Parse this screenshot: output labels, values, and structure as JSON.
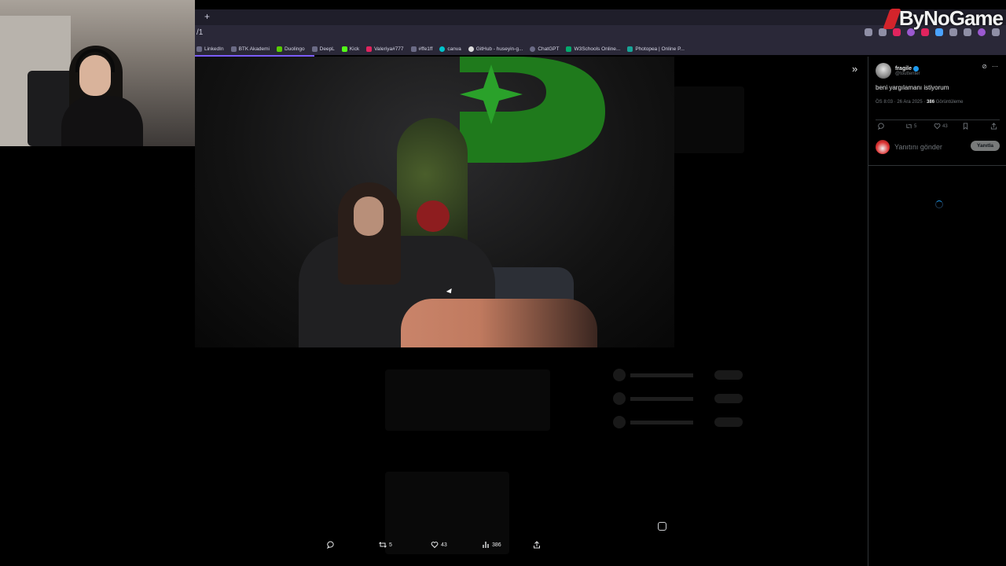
{
  "browser": {
    "new_tab_label": "+",
    "url": "/1",
    "bookmarks": [
      {
        "label": "LinkedIn",
        "icon": "linkedin-icon"
      },
      {
        "label": "BTK Akademi",
        "icon": "btk-icon"
      },
      {
        "label": "Duolingo",
        "icon": "duolingo-icon"
      },
      {
        "label": "DeepL",
        "icon": "deepl-icon"
      },
      {
        "label": "Kick",
        "icon": "kick-icon"
      },
      {
        "label": "Valeriya#777",
        "icon": "valeriya-icon"
      },
      {
        "label": "#ffe1ff",
        "icon": "color-icon"
      },
      {
        "label": "canva",
        "icon": "canva-icon"
      },
      {
        "label": "GitHub - huseyin-g...",
        "icon": "github-icon"
      },
      {
        "label": "ChatGPT",
        "icon": "chatgpt-icon"
      },
      {
        "label": "W3Schools Online...",
        "icon": "w3schools-icon"
      },
      {
        "label": "Photopea | Online P...",
        "icon": "photopea-icon"
      }
    ]
  },
  "watermark": {
    "text": "ByNoGame"
  },
  "viewer": {
    "expand_icon": "»",
    "actions": {
      "reply_count": "",
      "retweet_count": "5",
      "like_count": "43",
      "views_count": "386"
    }
  },
  "tweet": {
    "display_name": "fragile",
    "handle": "@touttenter",
    "text": "beni yargılamanı istiyorum",
    "timestamp": "ÖS 8:03 · 26 Ara 2025 ·",
    "views_number": "386",
    "views_label": "Görüntüleme",
    "stats": {
      "replies": "",
      "retweets": "5",
      "likes": "43"
    },
    "reply_placeholder": "Yanıtını gönder",
    "reply_button": "Yanıtla"
  },
  "colors": {
    "accent": "#1d9bf0",
    "brand_red": "#d3242b",
    "progress": "#7b5cff"
  }
}
